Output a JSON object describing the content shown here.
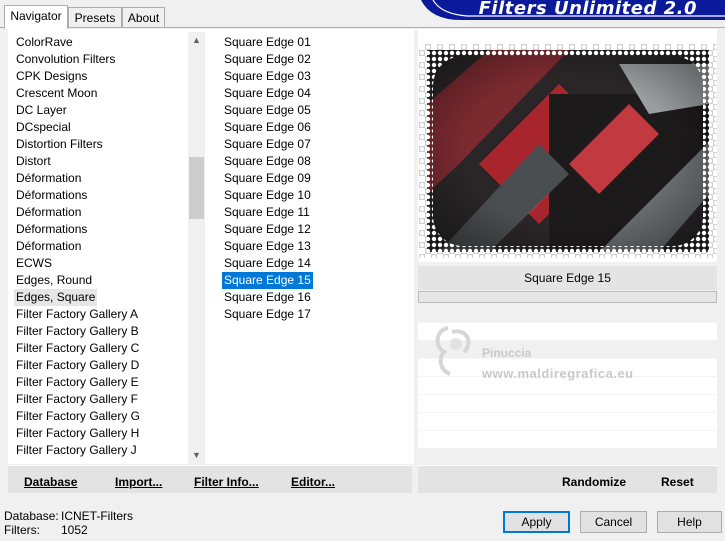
{
  "tabs": [
    {
      "label": "Navigator",
      "active": true
    },
    {
      "label": "Presets",
      "active": false
    },
    {
      "label": "About",
      "active": false
    }
  ],
  "banner": {
    "text": "Filters Unlimited 2.0",
    "color": "#0a1a9a"
  },
  "categories": {
    "items": [
      "ColorRave",
      "Convolution Filters",
      "CPK Designs",
      "Crescent Moon",
      "DC Layer",
      "DCspecial",
      "Distortion Filters",
      "Distort",
      "Déformation",
      "Déformations",
      "Déformation",
      "Déformations",
      "Déformation",
      "ECWS",
      "Edges, Round",
      "Edges, Square",
      "Filter Factory Gallery A",
      "Filter Factory Gallery B",
      "Filter Factory Gallery C",
      "Filter Factory Gallery D",
      "Filter Factory Gallery E",
      "Filter Factory Gallery F",
      "Filter Factory Gallery G",
      "Filter Factory Gallery H",
      "Filter Factory Gallery J"
    ],
    "selected_index": 15
  },
  "filters": {
    "items": [
      "Square Edge 01",
      "Square Edge 02",
      "Square Edge 03",
      "Square Edge 04",
      "Square Edge 05",
      "Square Edge 06",
      "Square Edge 07",
      "Square Edge 08",
      "Square Edge 09",
      "Square Edge 10",
      "Square Edge 11",
      "Square Edge 12",
      "Square Edge 13",
      "Square Edge 14",
      "Square Edge 15",
      "Square Edge 16",
      "Square Edge 17"
    ],
    "selected_index": 14
  },
  "left_buttons": {
    "database": "Database",
    "import": "Import...",
    "filter_info": "Filter Info...",
    "editor": "Editor..."
  },
  "preview": {
    "filter_name": "Square Edge 15"
  },
  "watermark": {
    "name": "Pinuccia",
    "url": "www.maldiregrafica.eu"
  },
  "right_buttons": {
    "randomize": "Randomize",
    "reset": "Reset"
  },
  "status": {
    "database_label": "Database:",
    "database_value": "ICNET-Filters",
    "filters_label": "Filters:",
    "filters_value": "1052"
  },
  "dialog_buttons": {
    "apply": "Apply",
    "cancel": "Cancel",
    "help": "Help"
  },
  "icons": {
    "scroll_up": "scroll-up-arrow-icon",
    "scroll_down": "scroll-down-arrow-icon"
  },
  "colors": {
    "selection": "#0078d7",
    "accent_red": "#b8202a"
  }
}
